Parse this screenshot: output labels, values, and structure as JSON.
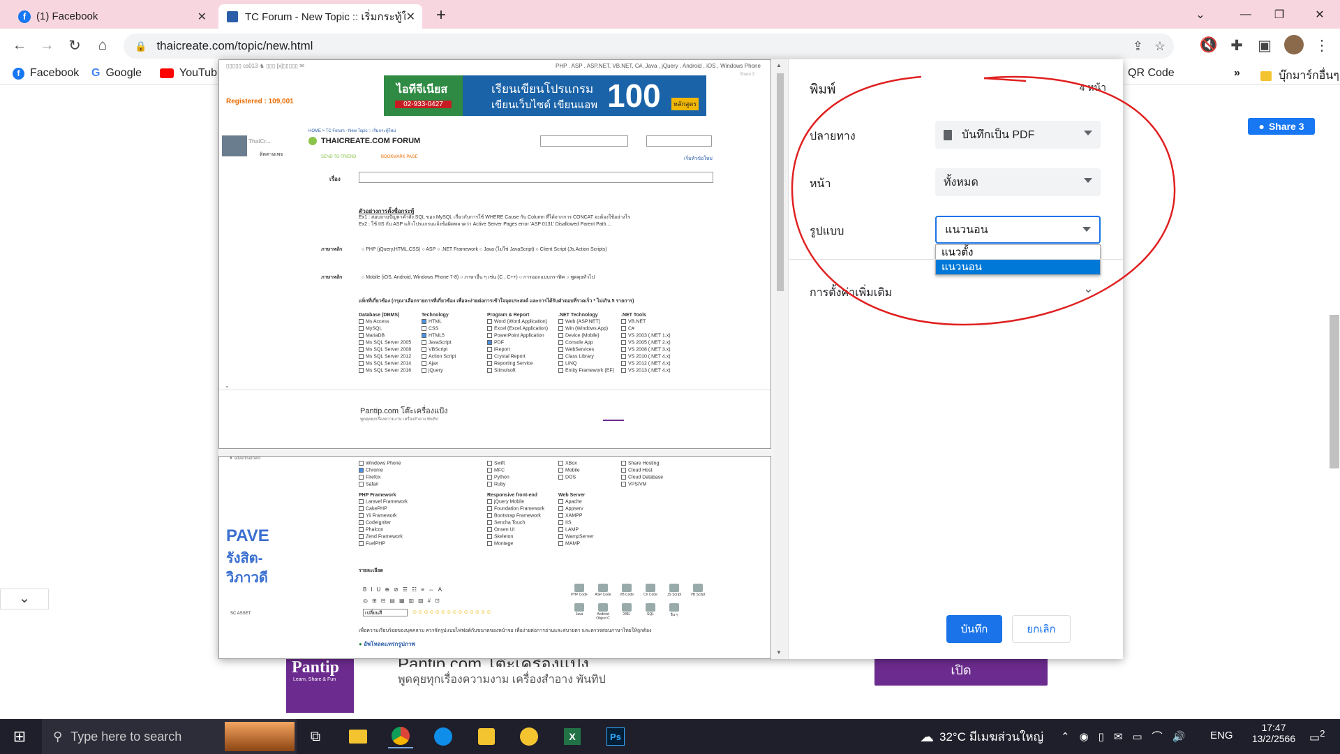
{
  "browser": {
    "tabs": [
      {
        "title": "(1) Facebook",
        "icon": "facebook-icon"
      },
      {
        "title": "TC Forum - New Topic :: เริ่มกระทู้ใ",
        "icon": "thaicreate-icon"
      }
    ],
    "new_tab": "+",
    "url": "thaicreate.com/topic/new.html",
    "bookmarks": [
      "Facebook",
      "Google",
      "YouTub",
      "QR Code",
      "บุ๊กมาร์กอื่นๆ"
    ],
    "bookmarks_more": "»"
  },
  "page": {
    "share_button": "Share 3",
    "ad": {
      "brand": "Pantip",
      "brand_tagline": "Learn, Share & Fun",
      "headline": "Pantip.com โต๊ะเครื่องแป้ง",
      "subline": "พูดคุยทุกเรื่องความงาม เครื่องสำอาง พันทิป",
      "open_button": "เปิด"
    }
  },
  "preview": {
    "header_links": "PHP . ASP . ASP.NET, VB.NET, C#, Java , jQuery , Android , iOS , Windows Phone",
    "share_small": "Share 3",
    "registered": "Registered : 109,001",
    "banner_left": "ไอทีจีเนียส",
    "banner_phone": "02-933-0427",
    "banner_text_1": "เรียนเขียนโปรแกรม",
    "banner_text_2": "เขียนเว็บไซต์ เขียนแอพ",
    "banner_number": "100",
    "banner_unit": "หลักสูตร",
    "breadcrumb": "HOME > TC Forum - New Topic :: เริ่มกระทู้ใหม่",
    "forum_title": "THAICREATE.COM FORUM",
    "send_to_friend": "SEND TO FRIEND",
    "bookmark_page": "BOOKMARK PAGE",
    "start_topic": "เริ่มหัวข้อใหม่",
    "subject_label": "เรื่อง",
    "example_heading": "ตัวอย่างการตั้งชื่อกระทู้",
    "example_1": "Ex1 : สอบถามปัญหาคำสั่ง SQL ของ MySQL เกี่ยวกับการใช้ WHERE Cause กับ Column ที่ได้จากการ CONCAT จะต้องใช้อย่างไร",
    "example_2": "Ex2 : ใช้ IIS กับ ASP แล้วโปรแกรมแจ้งข้อผิดพลาดว่า Active Server Pages error 'ASP 0131' Disallowed Parent Path....",
    "lang_label": "ภาษาหลัก",
    "lang_options": [
      "PHP (jQuery,HTML,CSS)",
      "ASP",
      ".NET Framework",
      "Java (ไม่ใช่ JavaScript)",
      "Client Script (Js,Action Scripts)"
    ],
    "lang_options_2": [
      "Mobile (iOS, Android, Windows Phone 7-8)",
      "ภาษาอื่น ๆ เช่น (C , C++)",
      "การออกแบบกราฟิค",
      "พูดคุยทั่วไป"
    ],
    "tags_heading": "แท็กที่เกี่ยวข้อง (กรุณาเลือกรายการที่เกี่ยวข้อง เพื่อจะง่ายต่อการเข้าใจจุดประสงค์ และการได้รับคำตอบที่รวดเร็ว * ไม่เกิน 5 รายการ)",
    "tag_columns": [
      {
        "title": "Database (DBMS)",
        "items": [
          "Ms Access",
          "MySQL",
          "MariaDB",
          "Ms SQL Server 2005",
          "Ms SQL Server 2008",
          "Ms SQL Server 2012",
          "Ms SQL Server 2014",
          "Ms SQL Server 2016"
        ]
      },
      {
        "title": "Technology",
        "items": [
          "HTML",
          "CSS",
          "HTML5",
          "JavaScript",
          "VBScript",
          "Action Script",
          "Ajax",
          "jQuery"
        ]
      },
      {
        "title": "Program & Report",
        "items": [
          "Word (Word.Application)",
          "Excel (Excel.Application)",
          "PowerPoint Application",
          "PDF",
          "iReport",
          "Crystal Report",
          "Reporting Service",
          "Stimulsoft"
        ]
      },
      {
        "title": ".NET Technology",
        "items": [
          "Web (ASP.NET)",
          "Win (Windows App)",
          "Device (Mobile)",
          "Console App",
          "WebServices",
          "Class Library",
          "LINQ",
          "Entity Framework (EF)"
        ]
      },
      {
        "title": ".NET Tools",
        "items": [
          "VB.NET",
          "C#",
          "VS 2003 (.NET 1.x)",
          "VS 2005 (.NET 2.x)",
          "VS 2008 (.NET 3.x)",
          "VS 2010 (.NET 4.x)",
          "VS 2012 (.NET 4.x)",
          "VS 2013 (.NET 4.x)"
        ]
      }
    ],
    "ad_title": "Pantip.com โต๊ะเครื่องแป้ง",
    "ad_sub": "พูดคุยทุกเรื่องความงาม เครื่องสำอาง พันทิป",
    "page2_advert": "▼ advertisement",
    "page2_left_text_1": "PAVE",
    "page2_left_text_2": "รังสิต-วิภาวดี",
    "page2_left_text_3": "SC ASSET",
    "page2_cols": [
      {
        "items": [
          "Windows Phone",
          "Chrome",
          "Firefox",
          "Safari"
        ]
      },
      {
        "items": [
          "Swift",
          "MFC",
          "Python",
          "Ruby"
        ]
      },
      {
        "items": [
          "XBox",
          "Mobile",
          "DOS"
        ]
      },
      {
        "items": [
          "Share Hosting",
          "Cloud Host",
          "Cloud Database",
          "VPS/VM"
        ]
      }
    ],
    "php_fw_title": "PHP Framework",
    "php_fw": [
      "Laravel Framework",
      "CakePHP",
      "Yii Framework",
      "CodeIgniter",
      "Phalcon",
      "Zend Framework",
      "FuelPHP"
    ],
    "resp_title": "Responsive front-end",
    "resp": [
      "jQuery Mobile",
      "Foundation Framework",
      "Bootstrap Framework",
      "Sencha Touch",
      "Onsen UI",
      "Skeleton",
      "Montage"
    ],
    "web_title": "Web Server",
    "web": [
      "Apache",
      "Appserv",
      "XAMPP",
      "IIS",
      "LAMP",
      "WampServer",
      "MAMP"
    ],
    "detail_label": "รายละเอียด",
    "code_icons": [
      "PHP Code",
      "ASP Code",
      "VB Code",
      "C# Code",
      "JS Script",
      "VB Script",
      "Java",
      "Android Object C",
      "XML",
      "SQL",
      "อื่น ๆ"
    ],
    "font_select": "เปลี่ยนสี",
    "note": "เพื่อความเรียบร้อยของบุคคลาม ควรจัดรูปแบบไฟฟอต์กับขนาดของหน้าจอ เพื่อง่ายต่อการอ่านและสบายตา และตรวจสอบภาษาไทยให้ถูกต้อง",
    "upload": "อัพโหลดแทรกรูปภาพ"
  },
  "print": {
    "title": "พิมพ์",
    "page_count": "4 หน้า",
    "destination_label": "ปลายทาง",
    "destination_value": "บันทึกเป็น PDF",
    "pages_label": "หน้า",
    "pages_value": "ทั้งหมด",
    "layout_label": "รูปแบบ",
    "layout_value": "แนวนอน",
    "layout_options": [
      "แนวตั้ง",
      "แนวนอน"
    ],
    "more_settings": "การตั้งค่าเพิ่มเติม",
    "save_button": "บันทึก",
    "cancel_button": "ยกเลิก"
  },
  "taskbar": {
    "search_placeholder": "Type here to search",
    "weather": "32°C มีเมฆส่วนใหญ่",
    "lang": "ENG",
    "time": "17:47",
    "date": "13/2/2566",
    "notifications": "2"
  },
  "colors": {
    "accent": "#1a73e8",
    "annotation": "#e02020",
    "tab_strip": "#f8d6e0",
    "taskbar": "#1f1f2b",
    "pantip_purple": "#6c2b8e"
  }
}
